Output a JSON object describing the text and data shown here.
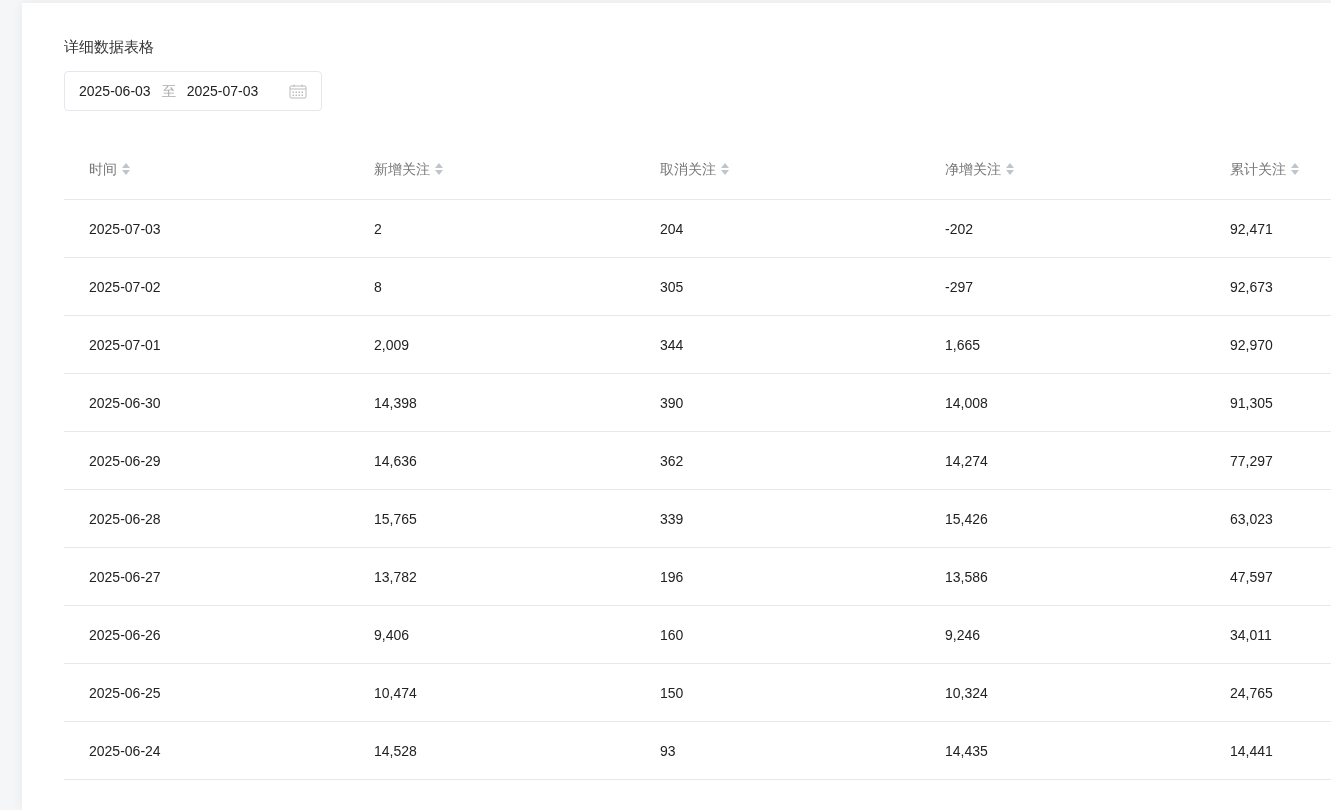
{
  "section_title": "详细数据表格",
  "date_range": {
    "start": "2025-06-03",
    "separator": "至",
    "end": "2025-07-03"
  },
  "table": {
    "columns": [
      "时间",
      "新增关注",
      "取消关注",
      "净增关注",
      "累计关注"
    ],
    "rows": [
      [
        "2025-07-03",
        "2",
        "204",
        "-202",
        "92,471"
      ],
      [
        "2025-07-02",
        "8",
        "305",
        "-297",
        "92,673"
      ],
      [
        "2025-07-01",
        "2,009",
        "344",
        "1,665",
        "92,970"
      ],
      [
        "2025-06-30",
        "14,398",
        "390",
        "14,008",
        "91,305"
      ],
      [
        "2025-06-29",
        "14,636",
        "362",
        "14,274",
        "77,297"
      ],
      [
        "2025-06-28",
        "15,765",
        "339",
        "15,426",
        "63,023"
      ],
      [
        "2025-06-27",
        "13,782",
        "196",
        "13,586",
        "47,597"
      ],
      [
        "2025-06-26",
        "9,406",
        "160",
        "9,246",
        "34,011"
      ],
      [
        "2025-06-25",
        "10,474",
        "150",
        "10,324",
        "24,765"
      ],
      [
        "2025-06-24",
        "14,528",
        "93",
        "14,435",
        "14,441"
      ]
    ]
  }
}
